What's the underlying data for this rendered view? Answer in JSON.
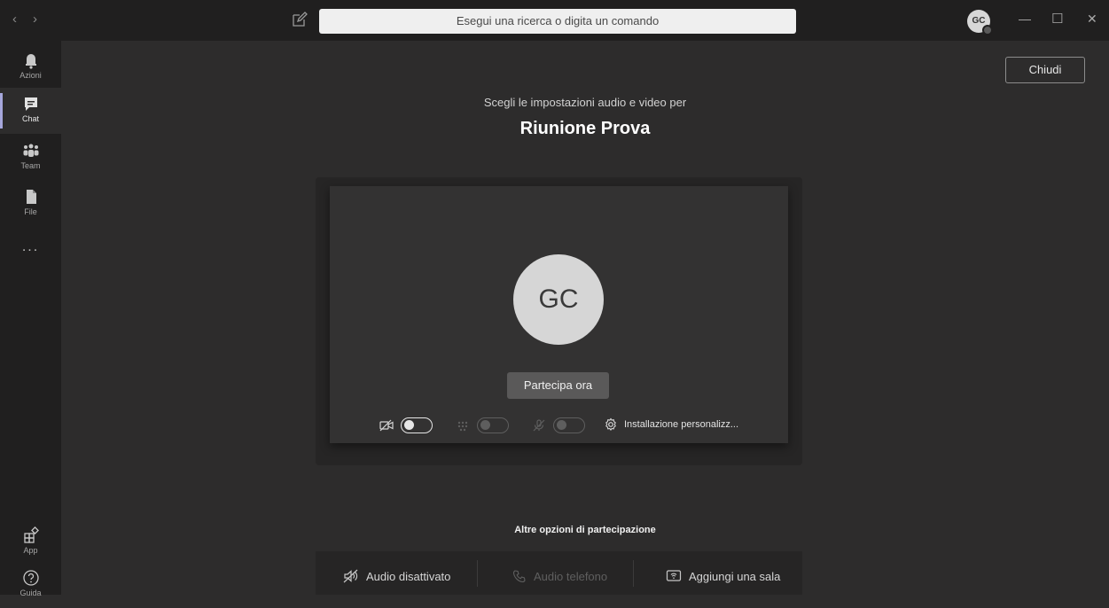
{
  "titlebar": {
    "back_icon": "chevron-left-icon",
    "forward_icon": "chevron-right-icon",
    "compose_icon": "compose-icon",
    "search_placeholder": "Esegui una ricerca o digita un comando",
    "user_initials": "GC",
    "minimize_icon": "minimize-icon",
    "maximize_icon": "maximize-icon",
    "close_icon": "close-icon"
  },
  "rail": {
    "items": [
      {
        "label": "Azioni",
        "icon": "bell-icon"
      },
      {
        "label": "Chat",
        "icon": "chat-icon"
      },
      {
        "label": "Team",
        "icon": "team-icon"
      },
      {
        "label": "File",
        "icon": "file-icon"
      }
    ],
    "more": "...",
    "bottom": [
      {
        "label": "App",
        "icon": "apps-icon"
      },
      {
        "label": "Guida",
        "icon": "help-icon"
      }
    ]
  },
  "main": {
    "close_label": "Chiudi",
    "subtitle": "Scegli le impostazioni audio e video per",
    "meeting_title": "Riunione Prova",
    "avatar_initials": "GC",
    "join_label": "Partecipa ora",
    "custom_setup_label": "Installazione personalizz...",
    "other_options_title": "Altre opzioni di partecipazione",
    "options": [
      {
        "label": "Audio disattivato",
        "icon": "speaker-off-icon"
      },
      {
        "label": "Audio telefono",
        "icon": "phone-icon"
      },
      {
        "label": "Aggiungi una sala",
        "icon": "room-icon"
      }
    ]
  },
  "colors": {
    "background": "#2d2c2c",
    "titlebar": "#201f1f",
    "panel": "#333232",
    "accent": "#a6a7dc"
  }
}
